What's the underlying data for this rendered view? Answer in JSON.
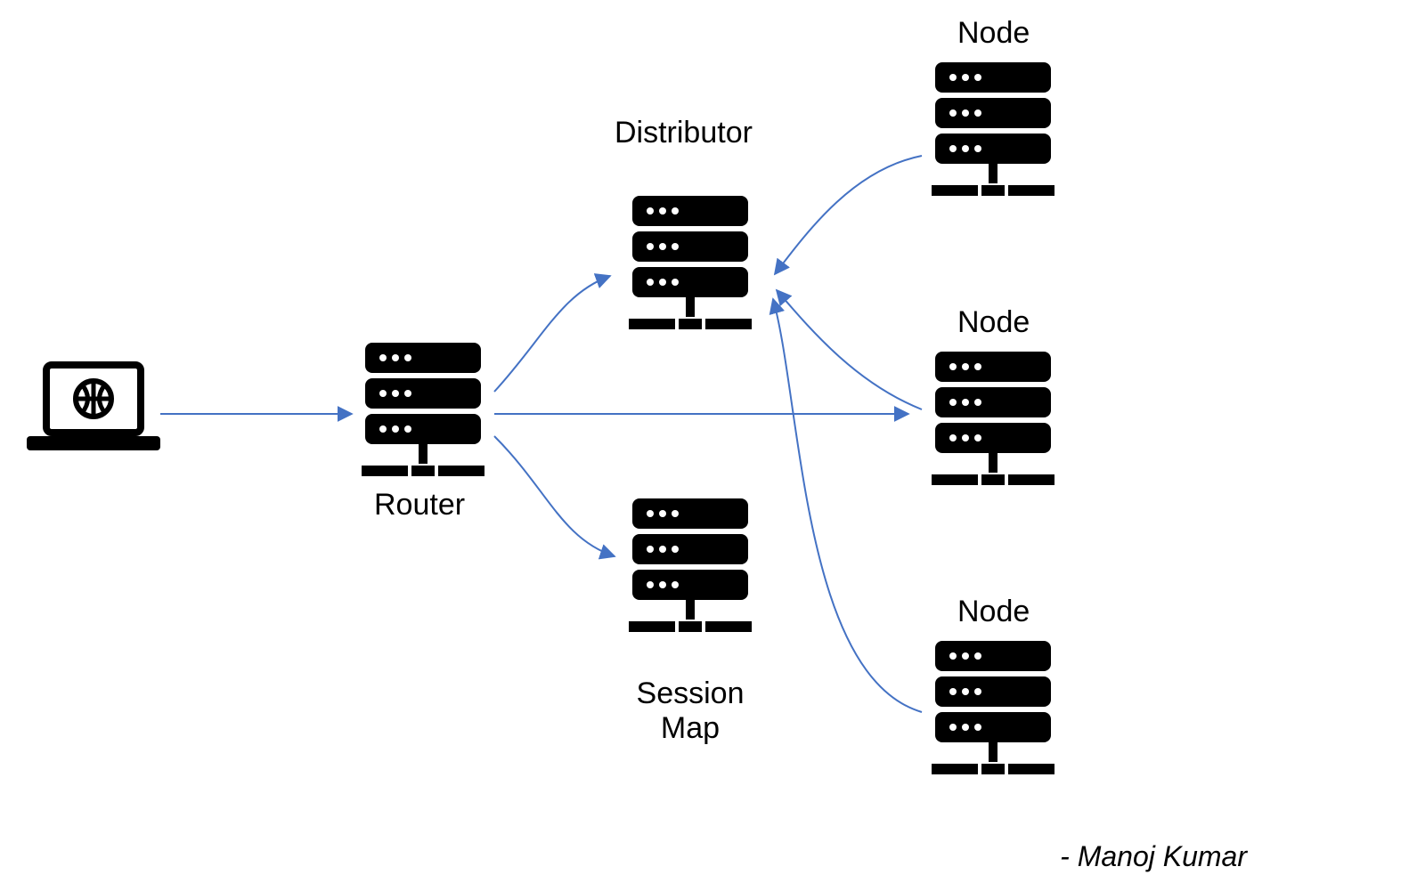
{
  "diagram": {
    "nodes": {
      "client": {
        "kind": "laptop",
        "label": ""
      },
      "router": {
        "kind": "server",
        "label": "Router"
      },
      "distributor": {
        "kind": "server",
        "label": "Distributor"
      },
      "sessionmap": {
        "kind": "server",
        "label": "Session\nMap"
      },
      "node1": {
        "kind": "server",
        "label": "Node"
      },
      "node2": {
        "kind": "server",
        "label": "Node"
      },
      "node3": {
        "kind": "server",
        "label": "Node"
      }
    },
    "edges": [
      {
        "from": "client",
        "to": "router",
        "style": "straight"
      },
      {
        "from": "router",
        "to": "distributor",
        "style": "curve-up"
      },
      {
        "from": "router",
        "to": "sessionmap",
        "style": "curve-down"
      },
      {
        "from": "router",
        "to": "node2",
        "style": "straight"
      },
      {
        "from": "node1",
        "to": "distributor",
        "style": "curve"
      },
      {
        "from": "node2",
        "to": "distributor",
        "style": "curve"
      },
      {
        "from": "node3",
        "to": "distributor",
        "style": "curve"
      }
    ],
    "arrow_color": "#4472C4"
  },
  "credit": "- Manoj Kumar"
}
